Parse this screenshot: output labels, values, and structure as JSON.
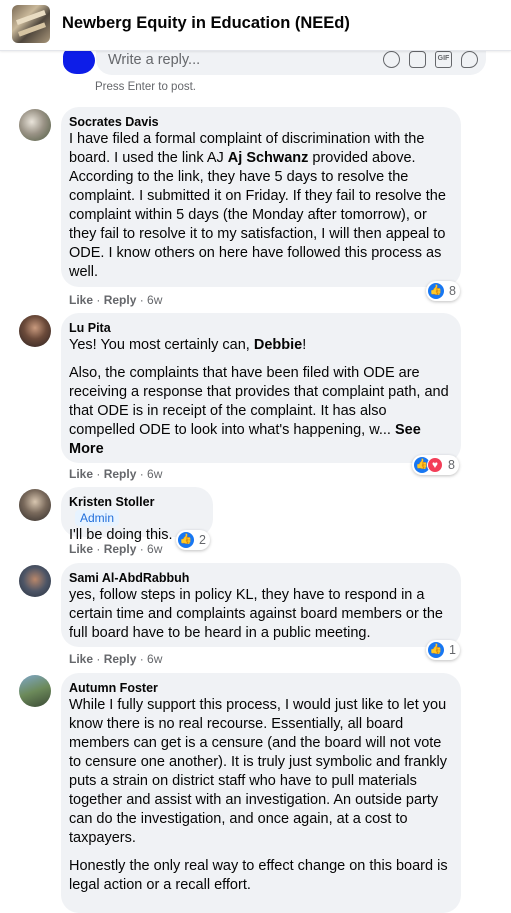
{
  "header": {
    "group_name": "Newberg Equity in Education (NEEd)"
  },
  "reply": {
    "placeholder": "Write a reply...",
    "hint": "Press Enter to post."
  },
  "icons": [
    "smile-icon",
    "camera-icon",
    "gif-icon",
    "sticker-icon",
    "like-reaction-icon",
    "love-reaction-icon"
  ],
  "colors": {
    "accent": "#1877f2",
    "love": "#f33e58",
    "bubble": "#f0f2f5",
    "secondary_text": "#65676b"
  },
  "comments": [
    {
      "author": "Socrates Davis",
      "p1_before": "I have filed a formal complaint of discrimination with the board. I used the link AJ ",
      "p1_mention": "Aj Schwanz",
      "p1_after": " provided above. According to the link, they have 5 days to resolve the complaint. I submitted it on Friday. If they fail to resolve the complaint within 5 days (the Monday after tomorrow), or they fail to resolve it to my satisfaction, I will then appeal to ODE. I know others on here have followed this process as well.",
      "like": "Like",
      "reply": "Reply",
      "time": "6w",
      "reaction_count": "8"
    },
    {
      "author": "Lu Pita",
      "p1_before": "Yes! You most certainly can, ",
      "p1_mention": "Debbie",
      "p1_after": "!",
      "p2": "Also, the complaints that have been filed with ODE are receiving a response that provides that complaint path, and that ODE is in receipt of the complaint. It has also compelled ODE to look into what's happening, w...",
      "see_more": "See More",
      "like": "Like",
      "reply": "Reply",
      "time": "6w",
      "reaction_count": "8"
    },
    {
      "author": "Kristen Stoller",
      "badge": "Admin",
      "p1": "I'll be doing this.",
      "like": "Like",
      "reply": "Reply",
      "time": "6w",
      "reaction_count": "2"
    },
    {
      "author": "Sami Al-AbdRabbuh",
      "p1": "yes, follow steps in policy KL, they have to respond in a certain time and complaints against board members or the full board have to be heard in a public meeting.",
      "like": "Like",
      "reply": "Reply",
      "time": "6w",
      "reaction_count": "1"
    },
    {
      "author": "Autumn Foster",
      "p1": "While I fully support this process, I would just like to let you know there is no real recourse. Essentially, all board members can get is a censure (and the board will not vote to censure one another). It is truly just symbolic and frankly puts a strain on district staff who have to pull materials together and assist with an investigation. An outside party can do the investigation, and once again, at a cost to taxpayers.",
      "p2": "Honestly the only real way to effect change on this board is legal action or a recall effort."
    }
  ]
}
